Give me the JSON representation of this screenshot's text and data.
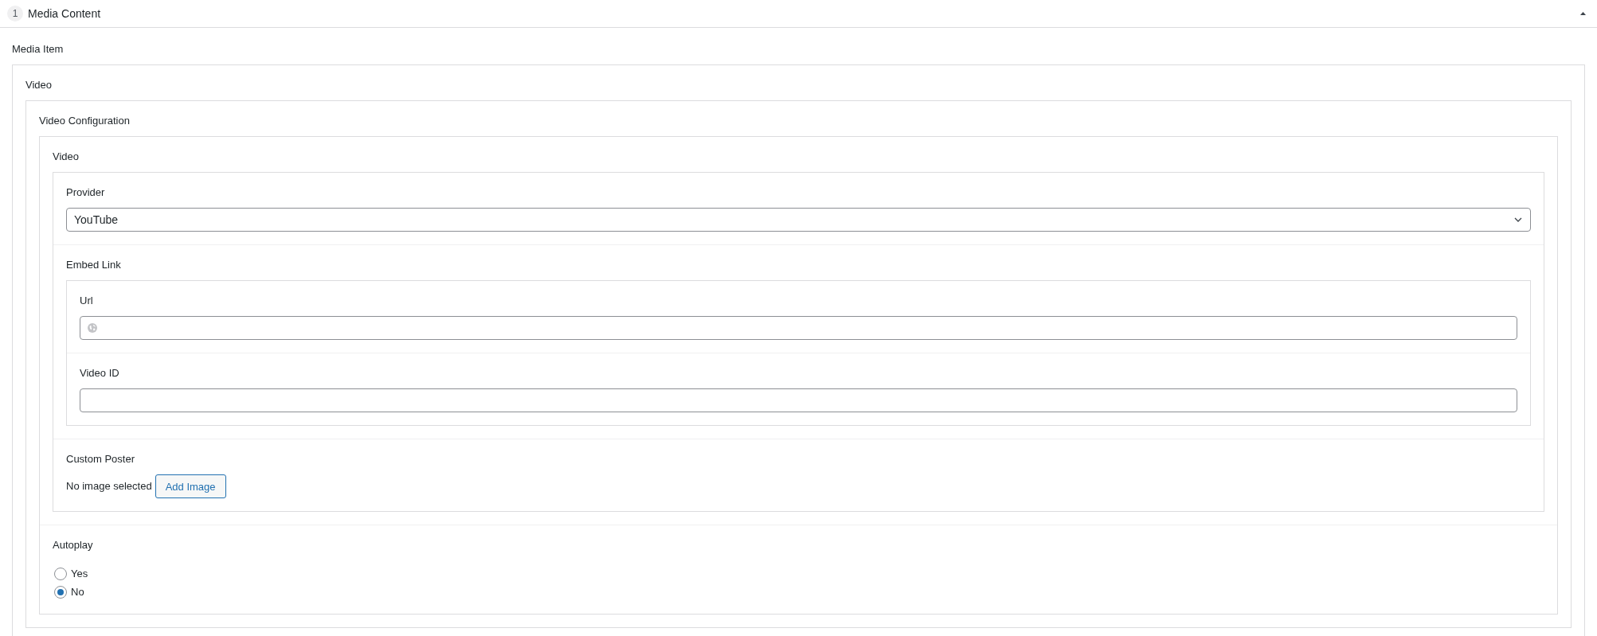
{
  "section": {
    "number": "1",
    "title": "Media Content",
    "expanded": true
  },
  "media_item": {
    "label": "Media Item",
    "video": {
      "label": "Video",
      "configuration": {
        "label": "Video Configuration",
        "video": {
          "label": "Video",
          "provider": {
            "label": "Provider",
            "value": "YouTube"
          },
          "embed_link": {
            "label": "Embed Link",
            "url": {
              "label": "Url"
            },
            "video_id": {
              "label": "Video ID"
            }
          },
          "custom_poster": {
            "label": "Custom Poster",
            "status": "No image selected",
            "button": "Add Image"
          }
        },
        "autoplay": {
          "label": "Autoplay",
          "options": [
            {
              "label": "Yes",
              "selected": false
            },
            {
              "label": "No",
              "selected": true
            }
          ]
        }
      }
    }
  }
}
